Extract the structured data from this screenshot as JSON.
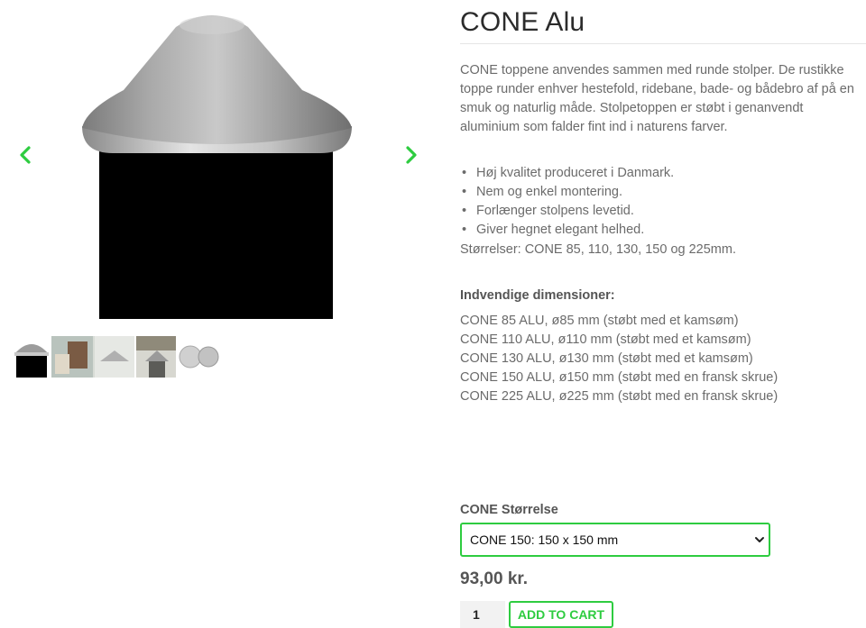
{
  "gallery": {
    "prev_icon": "chevron-left-icon",
    "next_icon": "chevron-right-icon",
    "arrow_color": "#2ecc40",
    "thumbnail_count": 4
  },
  "product": {
    "title": "CONE Alu",
    "description": "CONE toppene anvendes sammen med runde stolper. De rustikke toppe runder enhver hestefold, ridebane, bade- og bådebro af på en smuk og naturlig måde. Stolpetoppen er støbt i genanvendt aluminium som falder fint ind i naturens farver.",
    "features": [
      "Høj kvalitet produceret i Danmark.",
      "Nem og enkel montering.",
      "Forlænger stolpens levetid.",
      "Giver hegnet elegant helhed."
    ],
    "sizes": "Størrelser: CONE 85, 110, 130, 150 og 225mm.",
    "dims_heading": "Indvendige dimensioner:",
    "dims": [
      "CONE 85 ALU, ø85 mm (støbt med et kamsøm)",
      "CONE 110 ALU, ø110 mm (støbt med et kamsøm)",
      "CONE 130 ALU, ø130 mm (støbt med et kamsøm)",
      "CONE 150 ALU, ø150 mm (støbt med en fransk skrue)",
      "CONE 225 ALU, ø225 mm (støbt med en fransk skrue)"
    ],
    "variation_label": "CONE Størrelse",
    "variation_selected": "CONE 150: 150 x 150 mm",
    "price": "93,00 kr.",
    "quantity": "1",
    "add_to_cart_label": "ADD TO CART",
    "accent_color": "#2ecc40"
  }
}
